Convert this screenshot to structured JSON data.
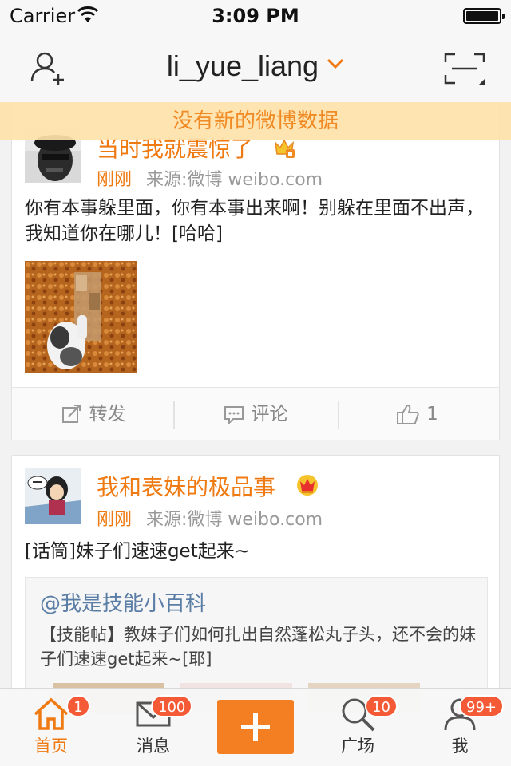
{
  "status_bar": {
    "carrier": "Carrier",
    "time": "3:09 PM"
  },
  "nav": {
    "title": "li_yue_liang",
    "left_icon": "add-friend-icon",
    "right_icon": "scan-icon",
    "caret_icon": "chevron-down-icon"
  },
  "notice": {
    "text": "没有新的微博数据"
  },
  "posts": [
    {
      "name": "当时我就震惊了",
      "time": "刚刚",
      "source": "来源:微博 weibo.com",
      "text": "你有本事躲里面，你有本事出来啊！别躲在里面不出声，我知道你在哪儿！[哈哈]",
      "actions": {
        "repost_label": "转发",
        "comment_label": "评论",
        "like_count": "1"
      }
    },
    {
      "name": "我和表妹的极品事",
      "time": "刚刚",
      "source": "来源:微博 weibo.com",
      "text": "[话筒]妹子们速速get起来~",
      "quote": {
        "user": "@我是技能小百科",
        "text": "【技能帖】教妹子们如何扎出自然蓬松丸子头，还不会的妹子们速速get起来~[耶]"
      }
    }
  ],
  "tab_bar": {
    "tabs": [
      {
        "label": "首页",
        "badge": "1",
        "icon": "home-icon"
      },
      {
        "label": "消息",
        "badge": "100",
        "icon": "message-icon"
      },
      {
        "label": "",
        "badge": "",
        "icon": "plus-icon"
      },
      {
        "label": "广场",
        "badge": "10",
        "icon": "discover-icon"
      },
      {
        "label": "我",
        "badge": "99+",
        "icon": "profile-icon"
      }
    ]
  },
  "colors": {
    "accent": "#f07a12",
    "badge": "#f35a35",
    "compose": "#f37f22",
    "notice_bg": "#fde2aa",
    "link": "#5b7ea6"
  }
}
